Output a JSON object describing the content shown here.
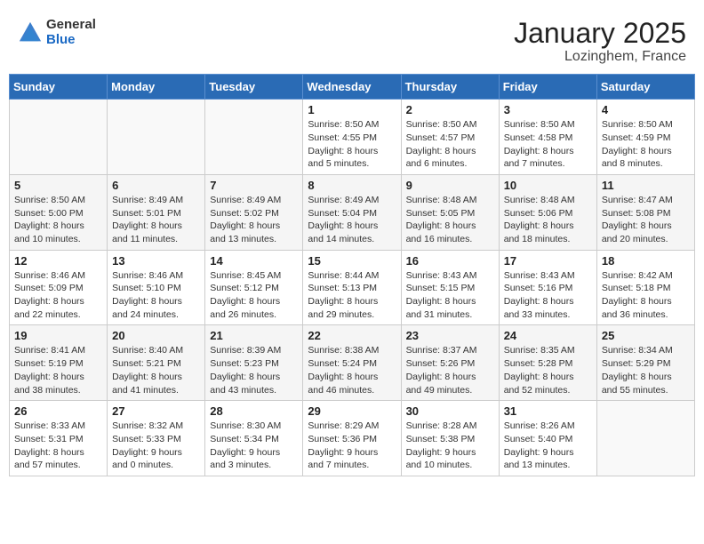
{
  "logo": {
    "general": "General",
    "blue": "Blue"
  },
  "header": {
    "title": "January 2025",
    "subtitle": "Lozinghem, France"
  },
  "days_of_week": [
    "Sunday",
    "Monday",
    "Tuesday",
    "Wednesday",
    "Thursday",
    "Friday",
    "Saturday"
  ],
  "weeks": [
    [
      {
        "day": "",
        "sunrise": "",
        "sunset": "",
        "daylight": ""
      },
      {
        "day": "",
        "sunrise": "",
        "sunset": "",
        "daylight": ""
      },
      {
        "day": "",
        "sunrise": "",
        "sunset": "",
        "daylight": ""
      },
      {
        "day": "1",
        "sunrise": "Sunrise: 8:50 AM",
        "sunset": "Sunset: 4:55 PM",
        "daylight": "Daylight: 8 hours and 5 minutes."
      },
      {
        "day": "2",
        "sunrise": "Sunrise: 8:50 AM",
        "sunset": "Sunset: 4:57 PM",
        "daylight": "Daylight: 8 hours and 6 minutes."
      },
      {
        "day": "3",
        "sunrise": "Sunrise: 8:50 AM",
        "sunset": "Sunset: 4:58 PM",
        "daylight": "Daylight: 8 hours and 7 minutes."
      },
      {
        "day": "4",
        "sunrise": "Sunrise: 8:50 AM",
        "sunset": "Sunset: 4:59 PM",
        "daylight": "Daylight: 8 hours and 8 minutes."
      }
    ],
    [
      {
        "day": "5",
        "sunrise": "Sunrise: 8:50 AM",
        "sunset": "Sunset: 5:00 PM",
        "daylight": "Daylight: 8 hours and 10 minutes."
      },
      {
        "day": "6",
        "sunrise": "Sunrise: 8:49 AM",
        "sunset": "Sunset: 5:01 PM",
        "daylight": "Daylight: 8 hours and 11 minutes."
      },
      {
        "day": "7",
        "sunrise": "Sunrise: 8:49 AM",
        "sunset": "Sunset: 5:02 PM",
        "daylight": "Daylight: 8 hours and 13 minutes."
      },
      {
        "day": "8",
        "sunrise": "Sunrise: 8:49 AM",
        "sunset": "Sunset: 5:04 PM",
        "daylight": "Daylight: 8 hours and 14 minutes."
      },
      {
        "day": "9",
        "sunrise": "Sunrise: 8:48 AM",
        "sunset": "Sunset: 5:05 PM",
        "daylight": "Daylight: 8 hours and 16 minutes."
      },
      {
        "day": "10",
        "sunrise": "Sunrise: 8:48 AM",
        "sunset": "Sunset: 5:06 PM",
        "daylight": "Daylight: 8 hours and 18 minutes."
      },
      {
        "day": "11",
        "sunrise": "Sunrise: 8:47 AM",
        "sunset": "Sunset: 5:08 PM",
        "daylight": "Daylight: 8 hours and 20 minutes."
      }
    ],
    [
      {
        "day": "12",
        "sunrise": "Sunrise: 8:46 AM",
        "sunset": "Sunset: 5:09 PM",
        "daylight": "Daylight: 8 hours and 22 minutes."
      },
      {
        "day": "13",
        "sunrise": "Sunrise: 8:46 AM",
        "sunset": "Sunset: 5:10 PM",
        "daylight": "Daylight: 8 hours and 24 minutes."
      },
      {
        "day": "14",
        "sunrise": "Sunrise: 8:45 AM",
        "sunset": "Sunset: 5:12 PM",
        "daylight": "Daylight: 8 hours and 26 minutes."
      },
      {
        "day": "15",
        "sunrise": "Sunrise: 8:44 AM",
        "sunset": "Sunset: 5:13 PM",
        "daylight": "Daylight: 8 hours and 29 minutes."
      },
      {
        "day": "16",
        "sunrise": "Sunrise: 8:43 AM",
        "sunset": "Sunset: 5:15 PM",
        "daylight": "Daylight: 8 hours and 31 minutes."
      },
      {
        "day": "17",
        "sunrise": "Sunrise: 8:43 AM",
        "sunset": "Sunset: 5:16 PM",
        "daylight": "Daylight: 8 hours and 33 minutes."
      },
      {
        "day": "18",
        "sunrise": "Sunrise: 8:42 AM",
        "sunset": "Sunset: 5:18 PM",
        "daylight": "Daylight: 8 hours and 36 minutes."
      }
    ],
    [
      {
        "day": "19",
        "sunrise": "Sunrise: 8:41 AM",
        "sunset": "Sunset: 5:19 PM",
        "daylight": "Daylight: 8 hours and 38 minutes."
      },
      {
        "day": "20",
        "sunrise": "Sunrise: 8:40 AM",
        "sunset": "Sunset: 5:21 PM",
        "daylight": "Daylight: 8 hours and 41 minutes."
      },
      {
        "day": "21",
        "sunrise": "Sunrise: 8:39 AM",
        "sunset": "Sunset: 5:23 PM",
        "daylight": "Daylight: 8 hours and 43 minutes."
      },
      {
        "day": "22",
        "sunrise": "Sunrise: 8:38 AM",
        "sunset": "Sunset: 5:24 PM",
        "daylight": "Daylight: 8 hours and 46 minutes."
      },
      {
        "day": "23",
        "sunrise": "Sunrise: 8:37 AM",
        "sunset": "Sunset: 5:26 PM",
        "daylight": "Daylight: 8 hours and 49 minutes."
      },
      {
        "day": "24",
        "sunrise": "Sunrise: 8:35 AM",
        "sunset": "Sunset: 5:28 PM",
        "daylight": "Daylight: 8 hours and 52 minutes."
      },
      {
        "day": "25",
        "sunrise": "Sunrise: 8:34 AM",
        "sunset": "Sunset: 5:29 PM",
        "daylight": "Daylight: 8 hours and 55 minutes."
      }
    ],
    [
      {
        "day": "26",
        "sunrise": "Sunrise: 8:33 AM",
        "sunset": "Sunset: 5:31 PM",
        "daylight": "Daylight: 8 hours and 57 minutes."
      },
      {
        "day": "27",
        "sunrise": "Sunrise: 8:32 AM",
        "sunset": "Sunset: 5:33 PM",
        "daylight": "Daylight: 9 hours and 0 minutes."
      },
      {
        "day": "28",
        "sunrise": "Sunrise: 8:30 AM",
        "sunset": "Sunset: 5:34 PM",
        "daylight": "Daylight: 9 hours and 3 minutes."
      },
      {
        "day": "29",
        "sunrise": "Sunrise: 8:29 AM",
        "sunset": "Sunset: 5:36 PM",
        "daylight": "Daylight: 9 hours and 7 minutes."
      },
      {
        "day": "30",
        "sunrise": "Sunrise: 8:28 AM",
        "sunset": "Sunset: 5:38 PM",
        "daylight": "Daylight: 9 hours and 10 minutes."
      },
      {
        "day": "31",
        "sunrise": "Sunrise: 8:26 AM",
        "sunset": "Sunset: 5:40 PM",
        "daylight": "Daylight: 9 hours and 13 minutes."
      },
      {
        "day": "",
        "sunrise": "",
        "sunset": "",
        "daylight": ""
      }
    ]
  ]
}
